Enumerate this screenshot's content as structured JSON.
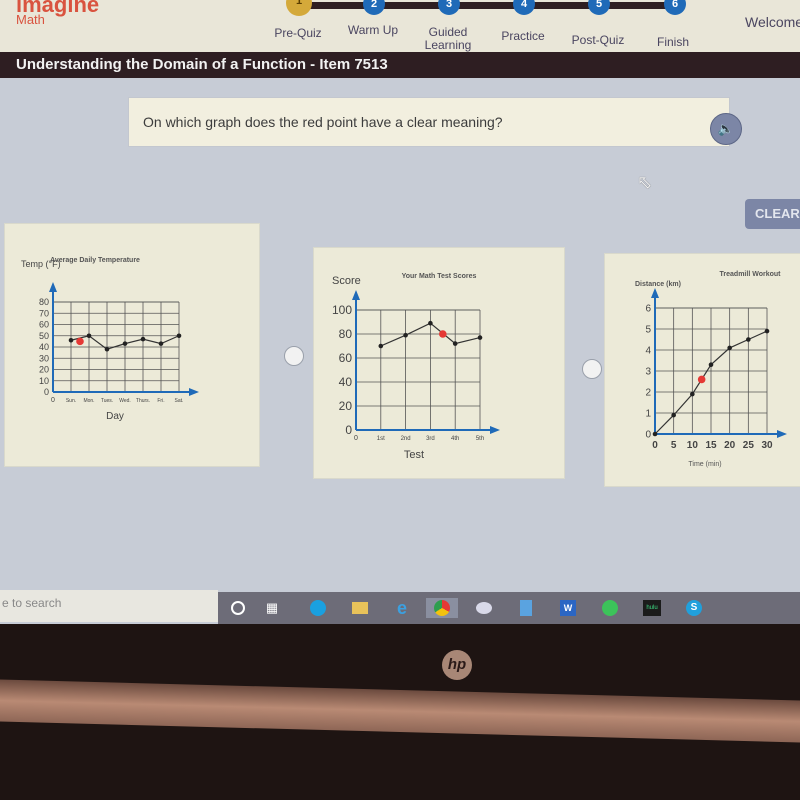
{
  "app": {
    "brand": "imagine",
    "subject": "Math"
  },
  "progress": {
    "steps": [
      {
        "number": "1",
        "label": "Pre-Quiz",
        "status": "done"
      },
      {
        "number": "2",
        "label": "Warm Up",
        "status": "todo"
      },
      {
        "number": "3",
        "label": "Guided Learning",
        "status": "todo"
      },
      {
        "number": "4",
        "label": "Practice",
        "status": "todo"
      },
      {
        "number": "5",
        "label": "Post-Quiz",
        "status": "todo"
      },
      {
        "number": "6",
        "label": "Finish",
        "status": "todo"
      }
    ]
  },
  "header": {
    "welcome": "Welcome",
    "title": "Understanding the Domain of a Function - Item 7513"
  },
  "question": {
    "text": "On which graph does the red point have a clear meaning?",
    "audio_icon": "speaker-icon"
  },
  "buttons": {
    "clear": "CLEAR"
  },
  "colors": {
    "highlight_point": "#e53935",
    "axis": "#1f6ab8",
    "line": "#333333"
  },
  "chart_data": [
    {
      "type": "line",
      "title": "Average Daily Temperature",
      "ylabel": "Temp (°F)",
      "xlabel": "Day",
      "categories": [
        "Sun.",
        "Mon.",
        "Tues.",
        "Wed.",
        "Thurs.",
        "Fri.",
        "Sat."
      ],
      "values": [
        46,
        50,
        38,
        43,
        47,
        43,
        50
      ],
      "highlight_point": {
        "x": 1.5,
        "y": 45
      },
      "yticks": [
        0,
        10,
        20,
        30,
        40,
        50,
        60,
        70,
        80
      ],
      "ylim": [
        0,
        80
      ],
      "x_origin_label": "0",
      "grid": true
    },
    {
      "type": "line",
      "title": "Your Math Test Scores",
      "ylabel": "Score",
      "xlabel": "Test",
      "categories": [
        "1st",
        "2nd",
        "3rd",
        "4th",
        "5th"
      ],
      "values": [
        70,
        79,
        89,
        72,
        77
      ],
      "highlight_point": {
        "x": 3.5,
        "y": 80
      },
      "yticks": [
        0,
        20,
        40,
        60,
        80,
        100
      ],
      "ylim": [
        0,
        100
      ],
      "x_origin_label": "0",
      "grid": true
    },
    {
      "type": "line",
      "title": "Treadmill Workout",
      "ylabel": "Distance (km)",
      "xlabel": "Time (min)",
      "x": [
        0,
        5,
        10,
        15,
        20,
        25,
        30
      ],
      "values": [
        0,
        0.9,
        1.9,
        3.3,
        4.1,
        4.5,
        4.9
      ],
      "highlight_point": {
        "x": 12.5,
        "y": 2.6
      },
      "yticks": [
        0,
        1,
        2,
        3,
        4,
        5,
        6
      ],
      "xticks": [
        0,
        5,
        10,
        15,
        20,
        25,
        30
      ],
      "ylim": [
        0,
        6
      ],
      "xlim": [
        0,
        30
      ],
      "grid": true
    }
  ],
  "taskbar": {
    "search_placeholder": "e to search",
    "icons": [
      "cortana-icon",
      "task-view-icon",
      "edge-icon",
      "file-explorer-icon",
      "internet-explorer-icon",
      "chrome-icon",
      "paint-icon",
      "calculator-icon",
      "word-icon",
      "whatsapp-icon",
      "hulu-icon",
      "skype-icon"
    ],
    "hulu_label": "hulu"
  },
  "device": {
    "logo": "hp"
  }
}
